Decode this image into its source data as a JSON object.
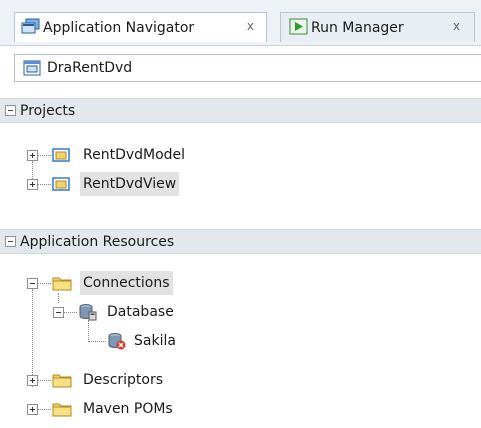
{
  "tabs": [
    {
      "label": "Application Navigator",
      "close": "x",
      "icon": "application-navigator-icon",
      "active": true
    },
    {
      "label": "Run Manager",
      "close": "x",
      "icon": "run-manager-icon",
      "active": false
    }
  ],
  "application_selector": {
    "label": "DraRentDvd",
    "icon": "application-icon"
  },
  "projects_section": {
    "label": "Projects",
    "expanded": true
  },
  "projects": [
    {
      "label": "RentDvdModel",
      "icon": "project-icon",
      "expanded": false
    },
    {
      "label": "RentDvdView",
      "icon": "project-icon",
      "expanded": false,
      "selected": true
    }
  ],
  "resources_section": {
    "label": "Application Resources",
    "expanded": true
  },
  "resources": {
    "connections": {
      "label": "Connections",
      "icon": "folder-icon",
      "expanded": true,
      "selected": true
    },
    "database": {
      "label": "Database",
      "icon": "database-icon",
      "expanded": true
    },
    "sakila": {
      "label": "Sakila",
      "icon": "database-connection-error-icon"
    },
    "descriptors": {
      "label": "Descriptors",
      "icon": "folder-icon",
      "expanded": false
    },
    "maven": {
      "label": "Maven POMs",
      "icon": "folder-icon",
      "expanded": false
    }
  },
  "colors": {
    "selection": "#e2e2e2",
    "section_header": "#e3e8ee",
    "folder": "#f2d36b",
    "project_blue": "#2f7bd6",
    "error_red": "#d83a2a"
  }
}
